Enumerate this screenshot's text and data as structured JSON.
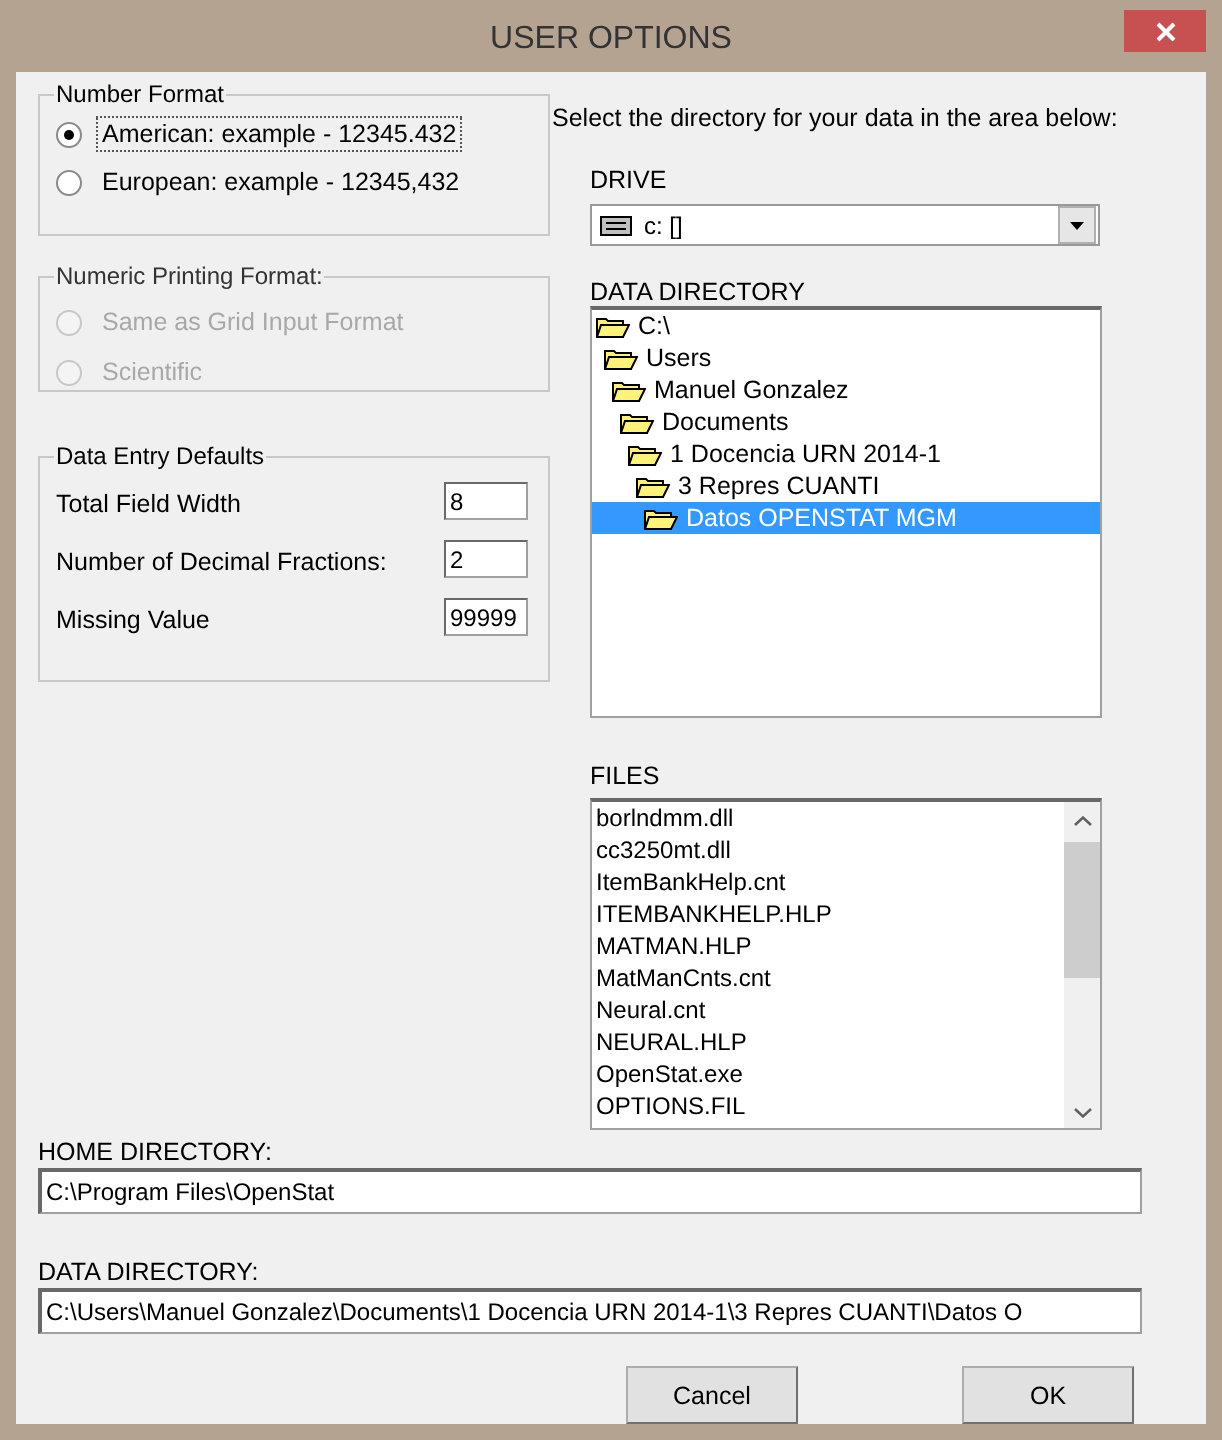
{
  "window": {
    "title": "USER OPTIONS"
  },
  "number_format": {
    "title": "Number Format",
    "options": [
      {
        "label": "American: example - 12345.432",
        "selected": true,
        "focused": true
      },
      {
        "label": "European: example - 12345,432",
        "selected": false,
        "focused": false
      }
    ]
  },
  "numeric_printing_format": {
    "title": "Numeric Printing Format:",
    "disabled": true,
    "options": [
      {
        "label": "Same as Grid Input Format",
        "selected": false
      },
      {
        "label": "Scientific",
        "selected": false
      }
    ]
  },
  "data_entry_defaults": {
    "title": "Data Entry Defaults",
    "fields": [
      {
        "label": "Total Field Width",
        "value": "8"
      },
      {
        "label": "Number of Decimal Fractions:",
        "value": "2"
      },
      {
        "label": "Missing Value",
        "value": "99999"
      }
    ]
  },
  "instruction": "Select the directory for your data in the area below:",
  "drive": {
    "label": "DRIVE",
    "value": "c: []"
  },
  "directory_tree": {
    "label": "DATA DIRECTORY",
    "items": [
      {
        "label": "C:\\",
        "selected": false,
        "children": [
          {
            "label": "Users",
            "selected": false,
            "children": [
              {
                "label": "Manuel Gonzalez",
                "selected": false,
                "children": [
                  {
                    "label": "Documents",
                    "selected": false,
                    "children": [
                      {
                        "label": "1 Docencia URN 2014-1",
                        "selected": false,
                        "children": [
                          {
                            "label": "3 Repres CUANTI",
                            "selected": false,
                            "children": [
                              {
                                "label": "Datos OPENSTAT MGM",
                                "selected": true
                              }
                            ]
                          }
                        ]
                      }
                    ]
                  }
                ]
              }
            ]
          }
        ]
      }
    ]
  },
  "files": {
    "label": "FILES",
    "items": [
      "borlndmm.dll",
      "cc3250mt.dll",
      "ItemBankHelp.cnt",
      "ITEMBANKHELP.HLP",
      "MATMAN.HLP",
      "MatManCnts.cnt",
      "Neural.cnt",
      "NEURAL.HLP",
      "OpenStat.exe",
      "OPTIONS.FIL"
    ]
  },
  "home_directory": {
    "label": "HOME DIRECTORY:",
    "value": "C:\\Program Files\\OpenStat"
  },
  "data_directory": {
    "label": "DATA DIRECTORY:",
    "value": "C:\\Users\\Manuel Gonzalez\\Documents\\1 Docencia URN 2014-1\\3 Repres CUANTI\\Datos O"
  },
  "buttons": [
    "Cancel",
    "OK"
  ]
}
